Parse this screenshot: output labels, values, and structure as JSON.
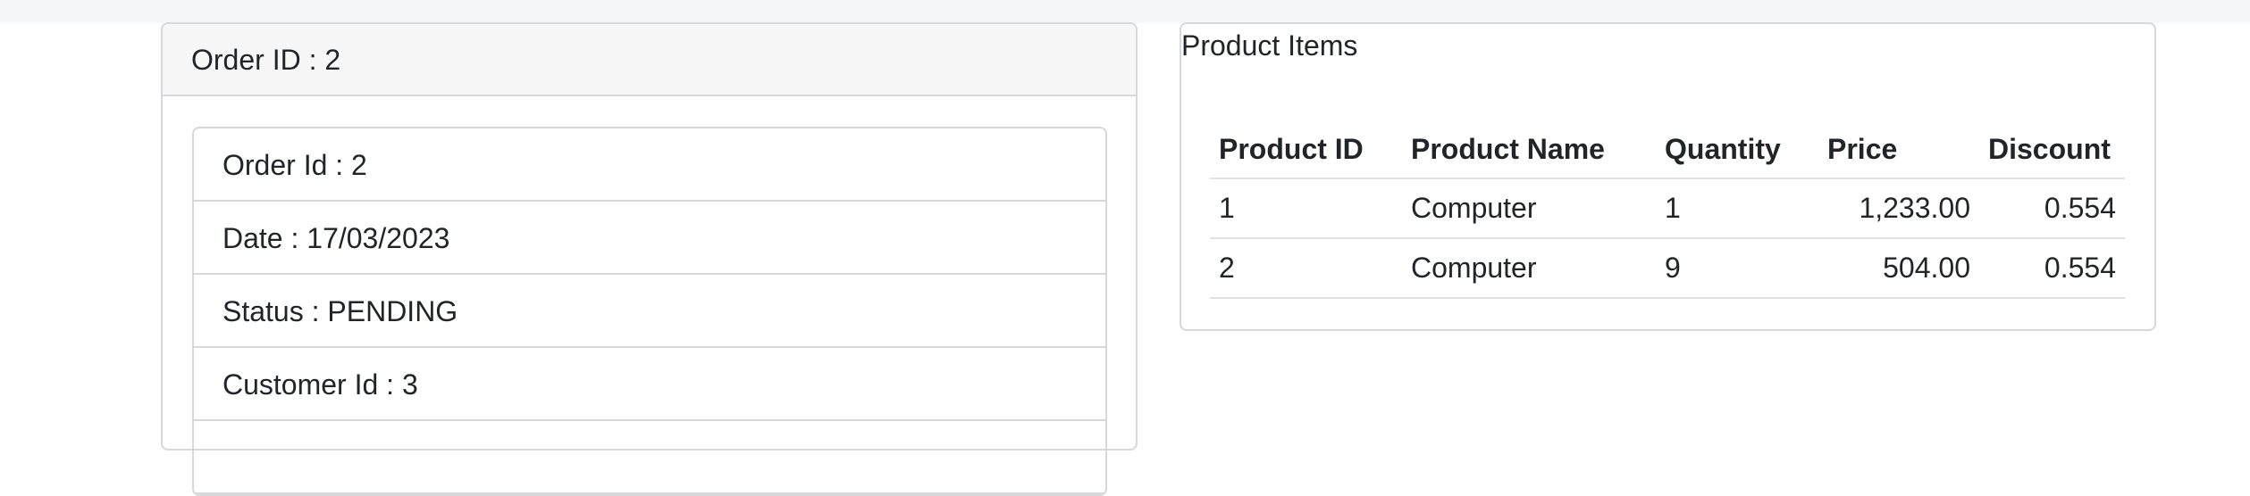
{
  "order_card": {
    "header": "Order ID : 2",
    "details": [
      {
        "label": "Order Id : 2"
      },
      {
        "label": "Date : 17/03/2023"
      },
      {
        "label": "Status : PENDING"
      },
      {
        "label": "Customer Id : 3"
      }
    ]
  },
  "product_items": {
    "title": "Product Items",
    "columns": [
      "Product ID",
      "Product Name",
      "Quantity",
      "Price",
      "Discount"
    ],
    "rows": [
      {
        "product_id": "1",
        "product_name": "Computer",
        "quantity": "1",
        "price": "1,233.00",
        "discount": "0.554"
      },
      {
        "product_id": "2",
        "product_name": "Computer",
        "quantity": "9",
        "price": "504.00",
        "discount": "0.554"
      }
    ]
  }
}
